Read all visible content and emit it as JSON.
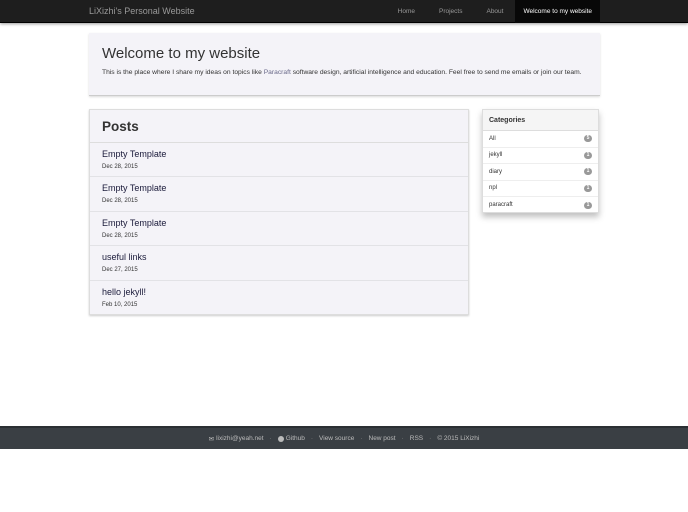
{
  "nav": {
    "brand": "LiXizhi's Personal Website",
    "links": [
      "Home",
      "Projects",
      "About",
      "Welcome to my website"
    ]
  },
  "jumbotron": {
    "title": "Welcome to my website",
    "text_before": "This is the place where I share my ideas on topics like ",
    "link": "Paracraft",
    "text_after": " software design, artificial intelligence and education. Feel free to send me emails or join our team."
  },
  "posts": {
    "title": "Posts",
    "items": [
      {
        "title": "Empty Template",
        "date": "Dec 28, 2015"
      },
      {
        "title": "Empty Template",
        "date": "Dec 28, 2015"
      },
      {
        "title": "Empty Template",
        "date": "Dec 28, 2015"
      },
      {
        "title": "useful links",
        "date": "Dec 27, 2015"
      },
      {
        "title": "hello jekyll!",
        "date": "Feb 10, 2015"
      }
    ]
  },
  "categories": {
    "title": "Categories",
    "items": [
      {
        "name": "All",
        "count": "5"
      },
      {
        "name": "jekyll",
        "count": "1"
      },
      {
        "name": "diary",
        "count": "1"
      },
      {
        "name": "npl",
        "count": "1"
      },
      {
        "name": "paracraft",
        "count": "1"
      }
    ]
  },
  "footer": {
    "email": "lixizhi@yeah.net",
    "github": "Github",
    "view_source": "View source",
    "new_post": "New post",
    "rss": "RSS",
    "copyright": "© 2015 LiXizhi",
    "sep": "·"
  }
}
